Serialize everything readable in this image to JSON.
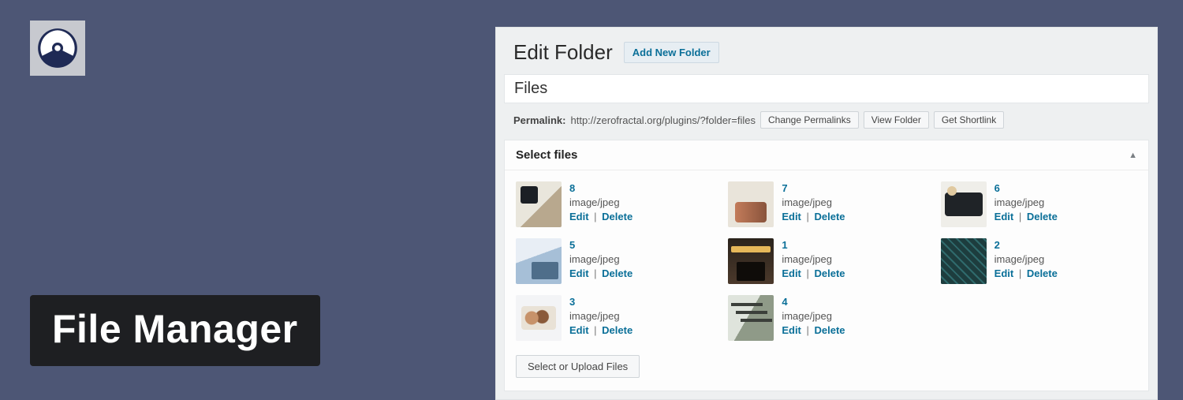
{
  "brand": {
    "title": "File Manager"
  },
  "panel": {
    "heading": "Edit Folder",
    "add_button": "Add New Folder",
    "title_value": "Files",
    "permalink": {
      "label": "Permalink:",
      "url": "http://zerofractal.org/plugins/?folder=files",
      "buttons": {
        "change": "Change Permalinks",
        "view": "View Folder",
        "shortlink": "Get Shortlink"
      }
    },
    "box": {
      "title": "Select files",
      "footer_button": "Select or Upload Files",
      "ops": {
        "edit": "Edit",
        "delete": "Delete",
        "sep": "|"
      }
    }
  },
  "files": [
    {
      "name": "8",
      "type": "image/jpeg",
      "thumb": "t0"
    },
    {
      "name": "7",
      "type": "image/jpeg",
      "thumb": "t1"
    },
    {
      "name": "6",
      "type": "image/jpeg",
      "thumb": "t2"
    },
    {
      "name": "5",
      "type": "image/jpeg",
      "thumb": "t3"
    },
    {
      "name": "1",
      "type": "image/jpeg",
      "thumb": "t4"
    },
    {
      "name": "2",
      "type": "image/jpeg",
      "thumb": "t5"
    },
    {
      "name": "3",
      "type": "image/jpeg",
      "thumb": "t6"
    },
    {
      "name": "4",
      "type": "image/jpeg",
      "thumb": "t7"
    }
  ]
}
